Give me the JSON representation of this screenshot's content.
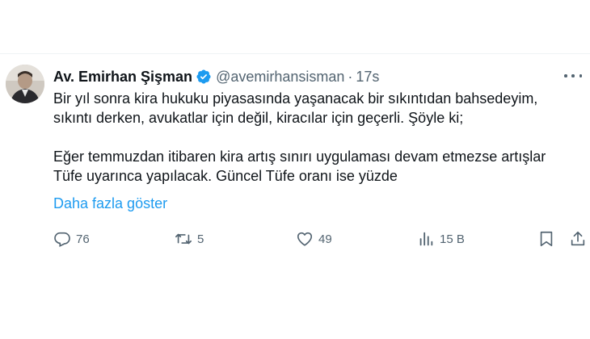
{
  "author": {
    "display_name": "Av. Emirhan Şişman",
    "handle": "@avemirhansisman",
    "separator": "·",
    "time": "17s"
  },
  "tweet": {
    "paragraph1": [
      "Bir yıl sonra kira hukuku piyasasında yaşanacak bir sıkıntıdan bahsedeyim,",
      "sıkıntı derken, avukatlar için değil, kiracılar için geçerli. Şöyle ki;"
    ],
    "paragraph2": [
      "Eğer temmuzdan itibaren kira artış sınırı uygulaması devam etmezse artışlar",
      "Tüfe uyarınca yapılacak. Güncel Tüfe oranı ise yüzde"
    ],
    "show_more": "Daha fazla göster"
  },
  "actions": {
    "replies": "76",
    "retweets": "5",
    "likes": "49",
    "views": "15 B"
  },
  "icons": {
    "verified": "verified-badge-icon",
    "more": "more-icon",
    "reply": "reply-icon",
    "retweet": "retweet-icon",
    "like": "heart-icon",
    "views": "views-icon",
    "bookmark": "bookmark-icon",
    "share": "share-icon"
  },
  "colors": {
    "accent": "#1d9bf0",
    "muted": "#536471",
    "text": "#0f1419"
  }
}
